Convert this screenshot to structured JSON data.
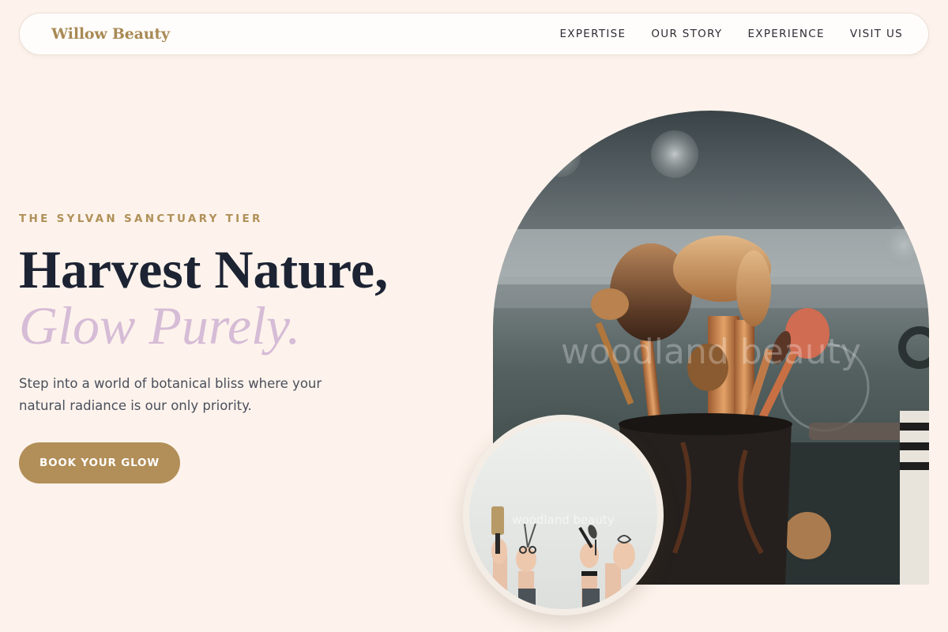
{
  "brand": {
    "name": "Willow Beauty"
  },
  "nav": {
    "links": [
      {
        "label": "EXPERTISE"
      },
      {
        "label": "OUR STORY"
      },
      {
        "label": "EXPERIENCE"
      },
      {
        "label": "VISIT US"
      }
    ]
  },
  "hero": {
    "eyebrow": "THE SYLVAN SANCTUARY TIER",
    "headline_line1": "Harvest Nature,",
    "headline_line2": "Glow Purely.",
    "subtext": "Step into a world of botanical bliss where your natural radiance is our only priority.",
    "cta_label": "BOOK YOUR GLOW"
  },
  "images": {
    "main_watermark": "woodland beauty",
    "secondary_watermark": "woodland beauty"
  },
  "colors": {
    "background": "#fdf3ec",
    "brand_gold": "#b28e58",
    "headline": "#1c2333",
    "accent_lavender": "#d6bcd6"
  }
}
